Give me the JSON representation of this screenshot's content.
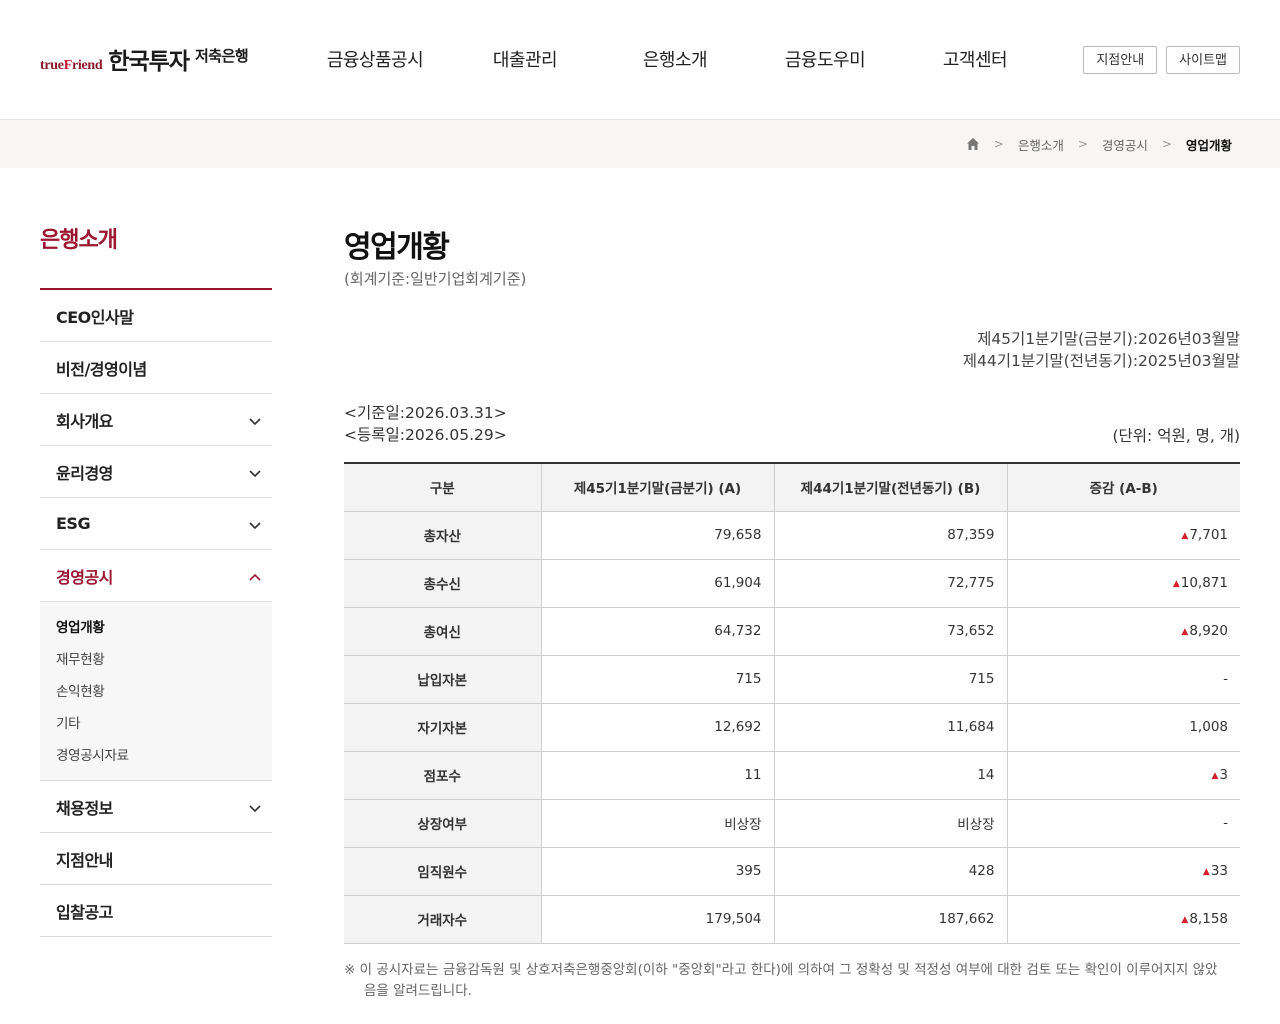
{
  "logo": {
    "tf_a": "true",
    "tf_b": "F",
    "tf_c": "riend",
    "name": "한국투자",
    "sub": "저축은행"
  },
  "gnb": [
    "금융상품공시",
    "대출관리",
    "은행소개",
    "금융도우미",
    "고객센터"
  ],
  "util": [
    "지점안내",
    "사이트맵"
  ],
  "breadcrumb": {
    "home_icon": "home-icon",
    "items": [
      "은행소개",
      "경영공시"
    ],
    "current": "영업개황"
  },
  "sidebar": {
    "title": "은행소개",
    "items": [
      {
        "label": "CEO인사말",
        "expandable": false
      },
      {
        "label": "비전/경영이념",
        "expandable": false
      },
      {
        "label": "회사개요",
        "expandable": true
      },
      {
        "label": "윤리경영",
        "expandable": true
      },
      {
        "label": "ESG",
        "expandable": true
      },
      {
        "label": "경영공시",
        "expandable": true,
        "active": true
      },
      {
        "label": "채용정보",
        "expandable": true
      },
      {
        "label": "지점안내",
        "expandable": false
      },
      {
        "label": "입찰공고",
        "expandable": false
      }
    ],
    "submenu": [
      "영업개황",
      "재무현황",
      "손익현황",
      "기타",
      "경영공시자료"
    ]
  },
  "content": {
    "title": "영업개황",
    "subtitle": "(회계기준:일반기업회계기준)",
    "period_current": "제45기1분기말(금분기):2026년03월말",
    "period_previous": "제44기1분기말(전년동기):2025년03월말",
    "base_date": "<기준일:2026.03.31>",
    "reg_date": "<등록일:2026.05.29>",
    "unit": "(단위: 억원, 명, 개)",
    "note": "※  이 공시자료는 금융감독원 및 상호저축은행중앙회(이하 \"중앙회\"라고 한다)에 의하여 그 정확성 및 적정성 여부에 대한 검토 또는 확인이 이루어지지 않았음을 알려드립니다."
  },
  "table": {
    "headers": [
      "구분",
      "제45기1분기말(금분기) (A)",
      "제44기1분기말(전년동기) (B)",
      "증감 (A-B)"
    ],
    "up_color": "#d81e2a",
    "rows": [
      {
        "label": "총자산",
        "a": "79,658",
        "b": "87,359",
        "diff": "7,701",
        "arrow": true
      },
      {
        "label": "총수신",
        "a": "61,904",
        "b": "72,775",
        "diff": "10,871",
        "arrow": true
      },
      {
        "label": "총여신",
        "a": "64,732",
        "b": "73,652",
        "diff": "8,920",
        "arrow": true
      },
      {
        "label": "납입자본",
        "a": "715",
        "b": "715",
        "diff": "-",
        "arrow": false
      },
      {
        "label": "자기자본",
        "a": "12,692",
        "b": "11,684",
        "diff": "1,008",
        "arrow": false
      },
      {
        "label": "점포수",
        "a": "11",
        "b": "14",
        "diff": "3",
        "arrow": true
      },
      {
        "label": "상장여부",
        "a": "비상장",
        "b": "비상장",
        "diff": "-",
        "arrow": false
      },
      {
        "label": "임직원수",
        "a": "395",
        "b": "428",
        "diff": "33",
        "arrow": true
      },
      {
        "label": "거래자수",
        "a": "179,504",
        "b": "187,662",
        "diff": "8,158",
        "arrow": true
      }
    ]
  }
}
